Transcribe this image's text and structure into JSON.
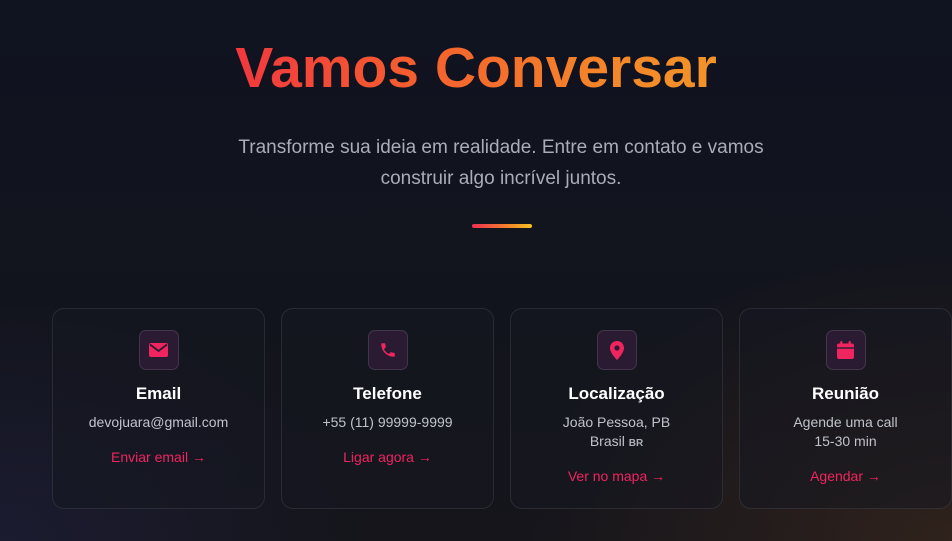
{
  "header": {
    "title": "Vamos Conversar",
    "subtitle_line1": "Transforme sua ideia em realidade. Entre em contato e vamos",
    "subtitle_line2": "construir algo incrível juntos."
  },
  "colors": {
    "accent": "#f0245e",
    "title_gradient_start": "#f2383e",
    "title_gradient_end": "#f29428"
  },
  "cards": [
    {
      "icon": "envelope-icon",
      "title": "Email",
      "line1": "devojuara@gmail.com",
      "action": "Enviar email →"
    },
    {
      "icon": "phone-icon",
      "title": "Telefone",
      "line1": "+55 (11) 99999-9999",
      "action": "Ligar agora →"
    },
    {
      "icon": "map-pin-icon",
      "title": "Localização",
      "line1": "João Pessoa, PB",
      "line2": "Brasil",
      "line2_badge": "BR",
      "action": "Ver no mapa →"
    },
    {
      "icon": "calendar-icon",
      "title": "Reunião",
      "line1": "Agende uma call",
      "line2": "15-30 min",
      "action": "Agendar →"
    }
  ]
}
